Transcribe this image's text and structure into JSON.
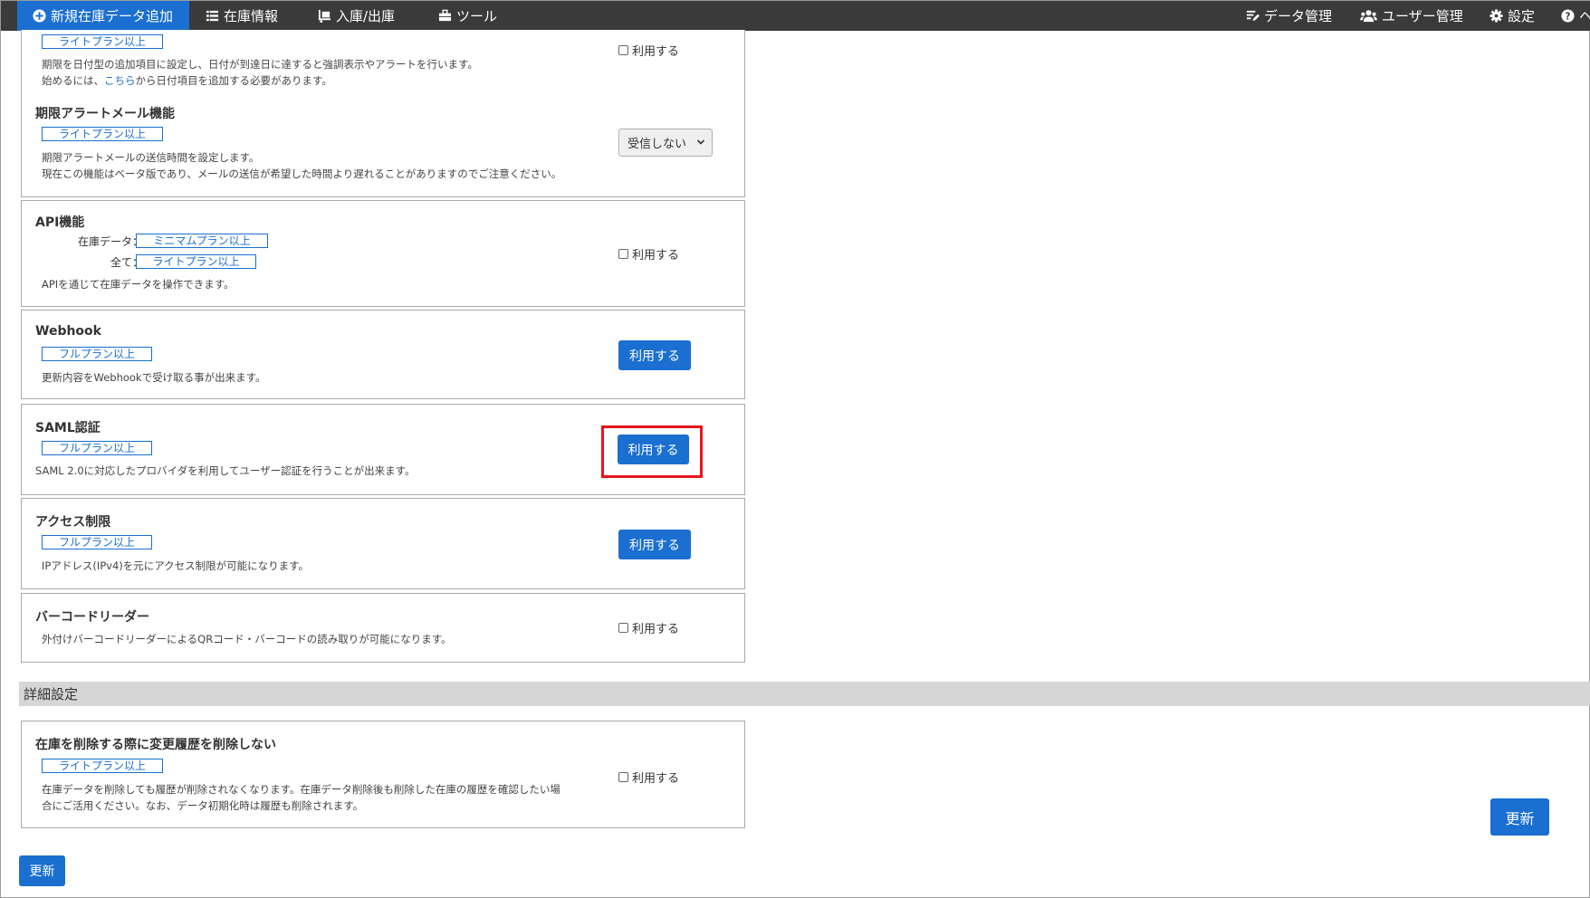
{
  "nav": {
    "new_item": "新規在庫データ追加",
    "inventory": "在庫情報",
    "inout": "入庫/出庫",
    "tools": "ツール",
    "data_mgmt": "データ管理",
    "user_mgmt": "ユーザー管理",
    "settings": "設定",
    "help": "ヘ"
  },
  "common": {
    "use_checkbox": "利用する",
    "use_button": "利用する"
  },
  "features": {
    "expiry": {
      "badge": "ライトプラン以上",
      "desc1": "期限を日付型の追加項目に設定し、日付が到達日に達すると強調表示やアラートを行います。",
      "desc2_pre": "始めるには、",
      "desc2_link": "こちら",
      "desc2_post": "から日付項目を追加する必要があります。"
    },
    "expiry_mail": {
      "title": "期限アラートメール機能",
      "badge": "ライトプラン以上",
      "desc1": "期限アラートメールの送信時間を設定します。",
      "desc2": "現在この機能はベータ版であり、メールの送信が希望した時間より遅れることがありますのでご注意ください。",
      "select_value": "受信しない"
    },
    "api": {
      "title": "API機能",
      "row1_label": "在庫データ：",
      "row1_badge": "ミニマムプラン以上",
      "row2_label": "全て：",
      "row2_badge": "ライトプラン以上",
      "desc": "APIを通じて在庫データを操作できます。"
    },
    "webhook": {
      "title": "Webhook",
      "badge": "フルプラン以上",
      "desc": "更新内容をWebhookで受け取る事が出来ます。"
    },
    "saml": {
      "title": "SAML認証",
      "badge": "フルプラン以上",
      "desc": "SAML 2.0に対応したプロバイダを利用してユーザー認証を行うことが出来ます。"
    },
    "access": {
      "title": "アクセス制限",
      "badge": "フルプラン以上",
      "desc": "IPアドレス(IPv4)を元にアクセス制限が可能になります。"
    },
    "barcode": {
      "title": "バーコードリーダー",
      "desc": "外付けバーコードリーダーによるQRコード・バーコードの読み取りが可能になります。"
    }
  },
  "advanced": {
    "section_title": "詳細設定",
    "keep_history": {
      "title": "在庫を削除する際に変更履歴を削除しない",
      "badge": "ライトプラン以上",
      "desc1": "在庫データを削除しても履歴が削除されなくなります。在庫データ削除後も削除した在庫の履歴を確認したい場",
      "desc2": "合にご活用ください。なお、データ初期化時は履歴も削除されます。"
    }
  },
  "buttons": {
    "update_right": "更新",
    "update_bottom": "更新"
  },
  "colors": {
    "accent": "#1a6fd1",
    "navbar": "#3a3a3a",
    "highlight": "#e8141b",
    "section_bar": "#d6d6d6"
  }
}
